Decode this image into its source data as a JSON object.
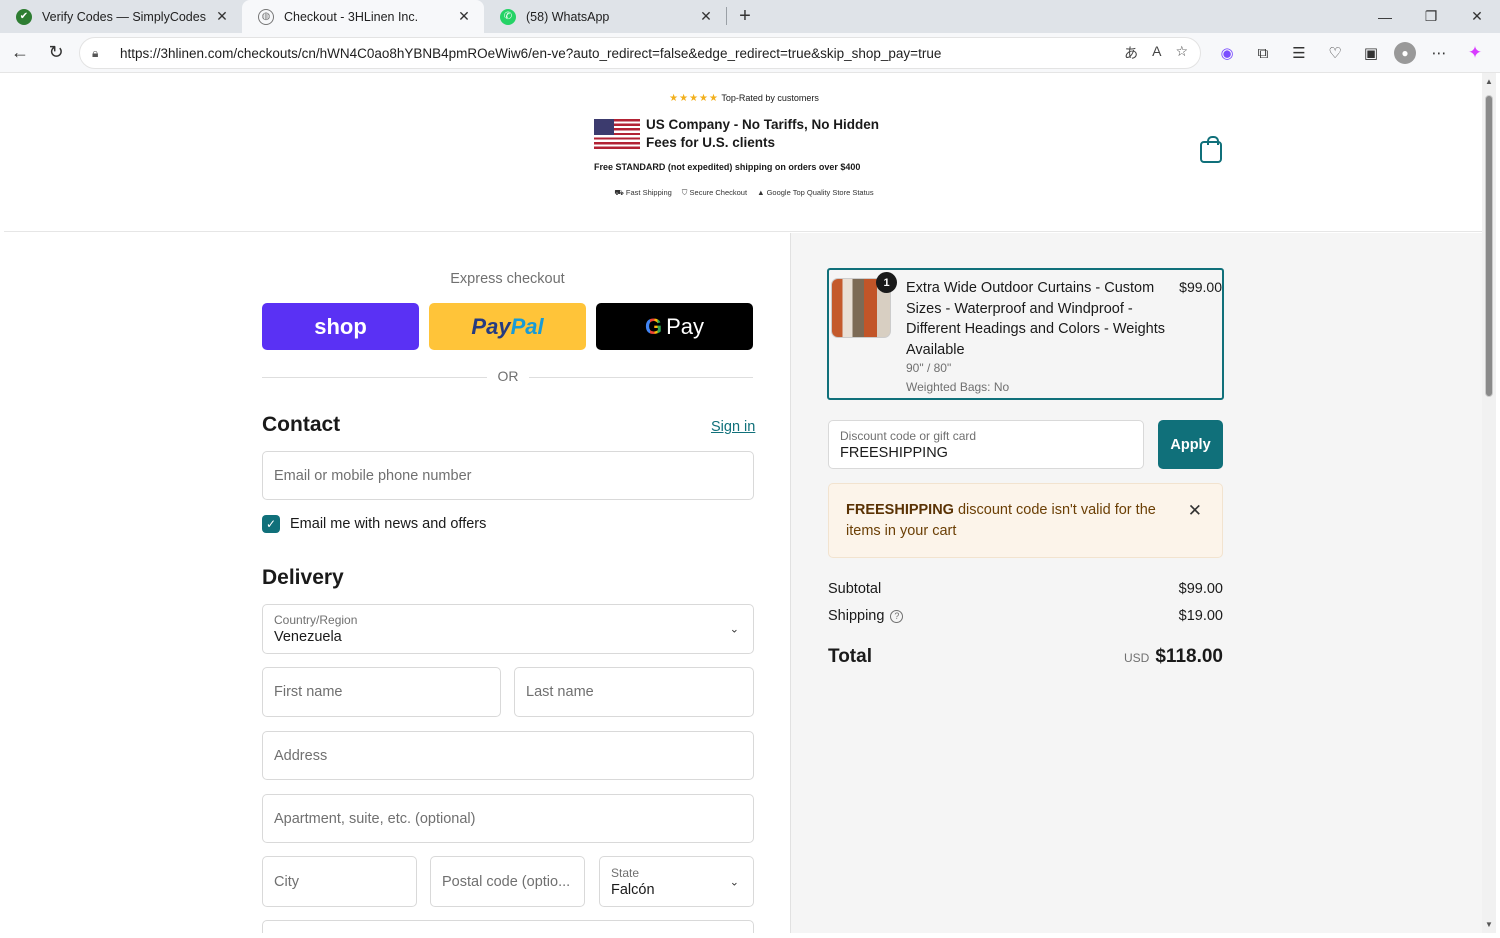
{
  "browser": {
    "tabs": [
      {
        "title": "Verify Codes — SimplyCodes",
        "active": false,
        "icon": "simplycodes-icon"
      },
      {
        "title": "Checkout - 3HLinen Inc.",
        "active": true,
        "icon": "globe-icon"
      },
      {
        "title": "(58) WhatsApp",
        "active": false,
        "icon": "whatsapp-icon"
      }
    ],
    "url": "https://3hlinen.com/checkouts/cn/hWN4C0ao8hYBNB4pmROeWiw6/en-ve?auto_redirect=false&edge_redirect=true&skip_shop_pay=true"
  },
  "header": {
    "stars": "★★★★★",
    "rating_text": "Top-Rated by customers",
    "us_company": "US Company - No Tariffs, No Hidden Fees for U.S. clients",
    "free_shipping": "Free STANDARD (not expedited) shipping on orders over $400",
    "badges": [
      "Fast Shipping",
      "Secure Checkout",
      "Google Top Quality Store Status"
    ]
  },
  "checkout": {
    "express_title": "Express checkout",
    "shop_label": "shop",
    "paypal_label_1": "Pay",
    "paypal_label_2": "Pal",
    "gpay_g": "G",
    "gpay_label": "Pay",
    "or_text": "OR",
    "contact_heading": "Contact",
    "sign_in": "Sign in",
    "email_placeholder": "Email or mobile phone number",
    "news_label": "Email me with news and offers",
    "delivery_heading": "Delivery",
    "country_label": "Country/Region",
    "country_value": "Venezuela",
    "first_name": "First name",
    "last_name": "Last name",
    "address": "Address",
    "apartment": "Apartment, suite, etc. (optional)",
    "city": "City",
    "postal": "Postal code (optio...",
    "state_label": "State",
    "state_value": "Falcón"
  },
  "summary": {
    "item": {
      "qty": "1",
      "name": "Extra Wide Outdoor Curtains - Custom Sizes - Waterproof and Windproof - Different Headings and Colors - Weights Available",
      "size": "90\" / 80\"",
      "weighted": "Weighted Bags: No",
      "price": "$99.00"
    },
    "discount_label": "Discount code or gift card",
    "discount_value": "FREESHIPPING",
    "apply": "Apply",
    "alert_code": "FREESHIPPING",
    "alert_text": " discount code isn't valid for the items in your cart",
    "subtotal_label": "Subtotal",
    "subtotal": "$99.00",
    "shipping_label": "Shipping",
    "shipping": "$19.00",
    "total_label": "Total",
    "currency": "USD",
    "total": "$118.00"
  },
  "colors": {
    "accent": "#10707a",
    "shop": "#5a31f4",
    "paypal": "#ffc439"
  }
}
